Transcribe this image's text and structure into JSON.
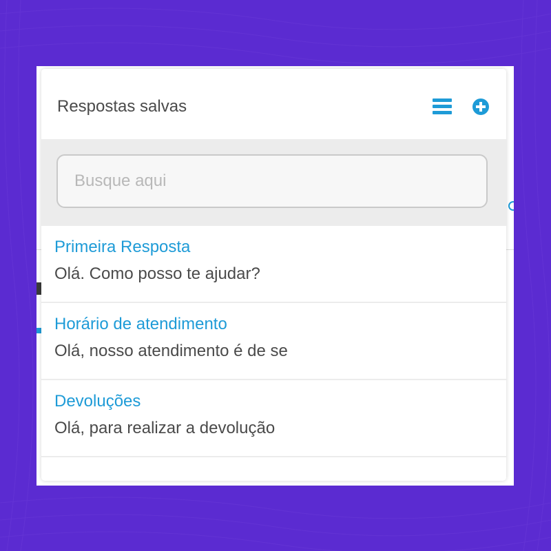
{
  "panel": {
    "title": "Respostas salvas",
    "icons": {
      "list": "list-icon",
      "add": "plus-circle-icon"
    },
    "accent_color": "#1e9bd7"
  },
  "search": {
    "placeholder": "Busque aqui",
    "value": ""
  },
  "replies": [
    {
      "title": "Primeira Resposta",
      "text": "Olá. Como posso te ajudar?"
    },
    {
      "title": "Horário de atendimento",
      "text": "Olá, nosso atendimento é de se"
    },
    {
      "title": "Devoluções",
      "text": "Olá, para realizar a devolução"
    }
  ],
  "background_color": "#5b2bd1"
}
